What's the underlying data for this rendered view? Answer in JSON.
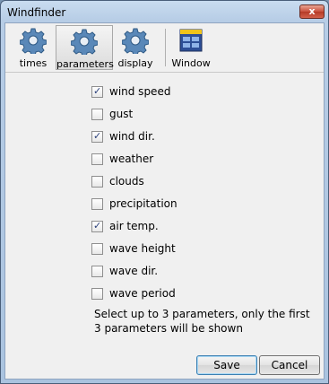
{
  "window": {
    "title": "Windfinder",
    "close_label": "x"
  },
  "toolbar": {
    "items": [
      {
        "label": "times",
        "icon": "gear-icon"
      },
      {
        "label": "parameters",
        "icon": "gear-icon",
        "active": true
      },
      {
        "label": "display",
        "icon": "gear-icon"
      },
      {
        "label": "Window",
        "icon": "window-icon"
      }
    ]
  },
  "parameters": [
    {
      "label": "wind speed",
      "checked": true
    },
    {
      "label": "gust",
      "checked": false
    },
    {
      "label": "wind dir.",
      "checked": true
    },
    {
      "label": "weather",
      "checked": false
    },
    {
      "label": "clouds",
      "checked": false
    },
    {
      "label": "precipitation",
      "checked": false
    },
    {
      "label": "air temp.",
      "checked": true
    },
    {
      "label": "wave height",
      "checked": false
    },
    {
      "label": "wave dir.",
      "checked": false
    },
    {
      "label": "wave period",
      "checked": false
    }
  ],
  "note": "Select up to 3 parameters, only the first 3 parameters will be shown",
  "buttons": {
    "save": "Save",
    "cancel": "Cancel"
  },
  "colors": {
    "accent": "#3c7fb1",
    "gear": "#5a88b8"
  }
}
